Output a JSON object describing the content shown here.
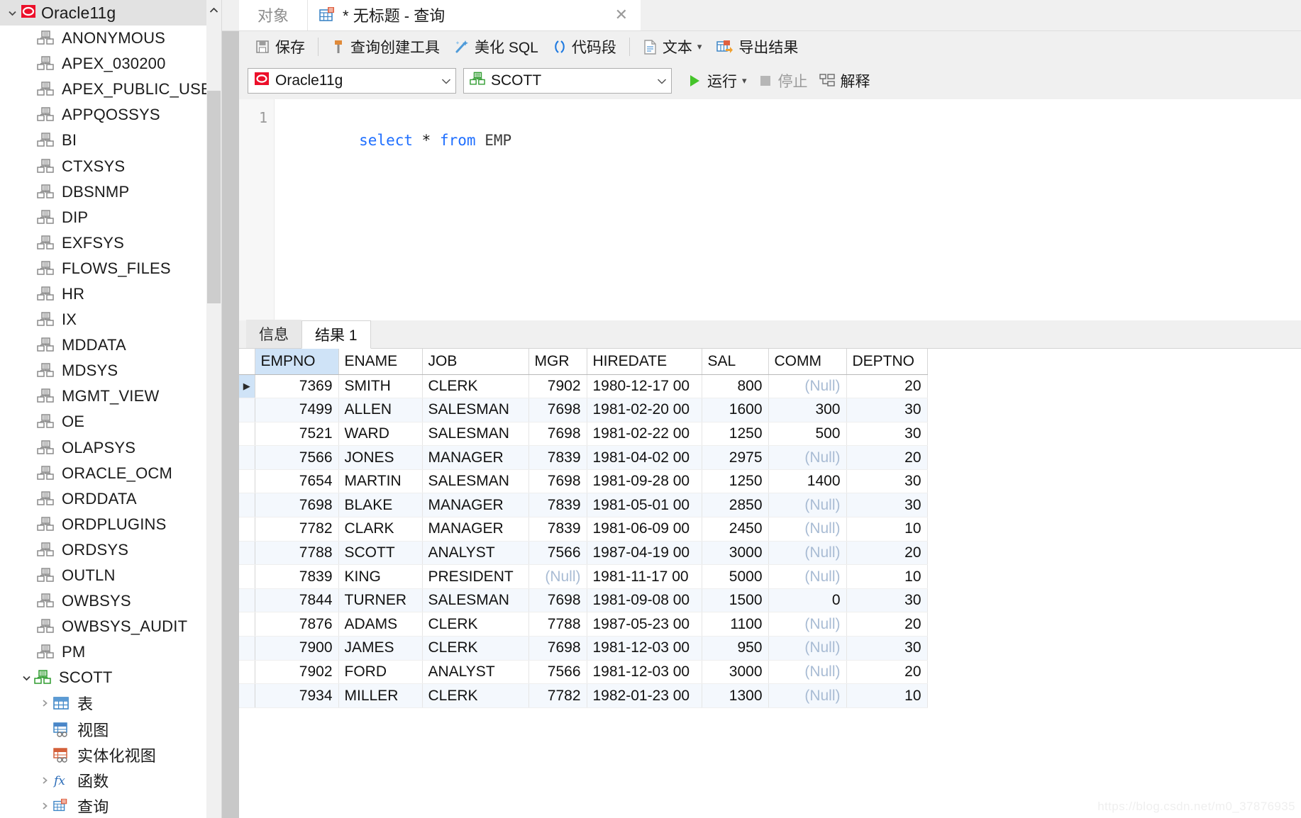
{
  "sidebar": {
    "root": {
      "label": "Oracle11g",
      "icon": "oracle-db-icon",
      "expanded": true
    },
    "users": [
      "ANONYMOUS",
      "APEX_030200",
      "APEX_PUBLIC_USER",
      "APPQOSSYS",
      "BI",
      "CTXSYS",
      "DBSNMP",
      "DIP",
      "EXFSYS",
      "FLOWS_FILES",
      "HR",
      "IX",
      "MDDATA",
      "MDSYS",
      "MGMT_VIEW",
      "OE",
      "OLAPSYS",
      "ORACLE_OCM",
      "ORDDATA",
      "ORDPLUGINS",
      "ORDSYS",
      "OUTLN",
      "OWBSYS",
      "OWBSYS_AUDIT",
      "PM"
    ],
    "scott": {
      "label": "SCOTT",
      "icon": "schema-icon",
      "expanded": true
    },
    "scott_children": [
      {
        "label": "表",
        "icon": "table-icon",
        "expandable": true
      },
      {
        "label": "视图",
        "icon": "view-icon",
        "expandable": false
      },
      {
        "label": "实体化视图",
        "icon": "materialized-view-icon",
        "expandable": false
      },
      {
        "label": "函数",
        "icon": "function-icon",
        "expandable": true
      },
      {
        "label": "查询",
        "icon": "query-icon",
        "expandable": true
      }
    ],
    "scroll_up_glyph": "⌃"
  },
  "tabs": {
    "object_tab": "对象",
    "query_tab": "* 无标题 - 查询",
    "close_glyph": "✕"
  },
  "toolbar": {
    "save": "保存",
    "query_builder": "查询创建工具",
    "beautify_sql": "美化 SQL",
    "code_snippet": "代码段",
    "text": "文本",
    "export_result": "导出结果",
    "dropdown_caret": "▾"
  },
  "toolbar2": {
    "connection": "Oracle11g",
    "schema": "SCOTT",
    "run": "运行",
    "stop": "停止",
    "explain": "解释",
    "combo_caret": "⌄",
    "run_caret": "▾"
  },
  "editor": {
    "line_number": "1",
    "sql_parts": [
      {
        "text": "select",
        "kind": "kw"
      },
      {
        "text": " ",
        "kind": "op"
      },
      {
        "text": "*",
        "kind": "op"
      },
      {
        "text": " ",
        "kind": "op"
      },
      {
        "text": "from",
        "kind": "kw"
      },
      {
        "text": " ",
        "kind": "op"
      },
      {
        "text": "EMP",
        "kind": "id"
      }
    ],
    "sql_text": "select * from EMP"
  },
  "results": {
    "tabs": [
      {
        "label": "信息",
        "active": false
      },
      {
        "label": "结果 1",
        "active": true
      }
    ],
    "columns": [
      "EMPNO",
      "ENAME",
      "JOB",
      "MGR",
      "HIREDATE",
      "SAL",
      "COMM",
      "DEPTNO"
    ],
    "selected_column": "EMPNO",
    "row_marker_glyph": "▶",
    "null_label": "(Null)",
    "rows": [
      {
        "EMPNO": "7369",
        "ENAME": "SMITH",
        "JOB": "CLERK",
        "MGR": "7902",
        "HIREDATE": "1980-12-17 00",
        "SAL": "800",
        "COMM": "(Null)",
        "DEPTNO": "20"
      },
      {
        "EMPNO": "7499",
        "ENAME": "ALLEN",
        "JOB": "SALESMAN",
        "MGR": "7698",
        "HIREDATE": "1981-02-20 00",
        "SAL": "1600",
        "COMM": "300",
        "DEPTNO": "30"
      },
      {
        "EMPNO": "7521",
        "ENAME": "WARD",
        "JOB": "SALESMAN",
        "MGR": "7698",
        "HIREDATE": "1981-02-22 00",
        "SAL": "1250",
        "COMM": "500",
        "DEPTNO": "30"
      },
      {
        "EMPNO": "7566",
        "ENAME": "JONES",
        "JOB": "MANAGER",
        "MGR": "7839",
        "HIREDATE": "1981-04-02 00",
        "SAL": "2975",
        "COMM": "(Null)",
        "DEPTNO": "20"
      },
      {
        "EMPNO": "7654",
        "ENAME": "MARTIN",
        "JOB": "SALESMAN",
        "MGR": "7698",
        "HIREDATE": "1981-09-28 00",
        "SAL": "1250",
        "COMM": "1400",
        "DEPTNO": "30"
      },
      {
        "EMPNO": "7698",
        "ENAME": "BLAKE",
        "JOB": "MANAGER",
        "MGR": "7839",
        "HIREDATE": "1981-05-01 00",
        "SAL": "2850",
        "COMM": "(Null)",
        "DEPTNO": "30"
      },
      {
        "EMPNO": "7782",
        "ENAME": "CLARK",
        "JOB": "MANAGER",
        "MGR": "7839",
        "HIREDATE": "1981-06-09 00",
        "SAL": "2450",
        "COMM": "(Null)",
        "DEPTNO": "10"
      },
      {
        "EMPNO": "7788",
        "ENAME": "SCOTT",
        "JOB": "ANALYST",
        "MGR": "7566",
        "HIREDATE": "1987-04-19 00",
        "SAL": "3000",
        "COMM": "(Null)",
        "DEPTNO": "20"
      },
      {
        "EMPNO": "7839",
        "ENAME": "KING",
        "JOB": "PRESIDENT",
        "MGR": "(Null)",
        "HIREDATE": "1981-11-17 00",
        "SAL": "5000",
        "COMM": "(Null)",
        "DEPTNO": "10"
      },
      {
        "EMPNO": "7844",
        "ENAME": "TURNER",
        "JOB": "SALESMAN",
        "MGR": "7698",
        "HIREDATE": "1981-09-08 00",
        "SAL": "1500",
        "COMM": "0",
        "DEPTNO": "30"
      },
      {
        "EMPNO": "7876",
        "ENAME": "ADAMS",
        "JOB": "CLERK",
        "MGR": "7788",
        "HIREDATE": "1987-05-23 00",
        "SAL": "1100",
        "COMM": "(Null)",
        "DEPTNO": "20"
      },
      {
        "EMPNO": "7900",
        "ENAME": "JAMES",
        "JOB": "CLERK",
        "MGR": "7698",
        "HIREDATE": "1981-12-03 00",
        "SAL": "950",
        "COMM": "(Null)",
        "DEPTNO": "30"
      },
      {
        "EMPNO": "7902",
        "ENAME": "FORD",
        "JOB": "ANALYST",
        "MGR": "7566",
        "HIREDATE": "1981-12-03 00",
        "SAL": "3000",
        "COMM": "(Null)",
        "DEPTNO": "20"
      },
      {
        "EMPNO": "7934",
        "ENAME": "MILLER",
        "JOB": "CLERK",
        "MGR": "7782",
        "HIREDATE": "1982-01-23 00",
        "SAL": "1300",
        "COMM": "(Null)",
        "DEPTNO": "10"
      }
    ]
  },
  "watermark": "https://blog.csdn.net/m0_37876935",
  "colors": {
    "accent_blue": "#1f6fff",
    "oracle_red": "#e8112d",
    "schema_green": "#3aa23a",
    "run_green": "#3dbb2f",
    "selected_header": "#cfe3f7",
    "null_text": "#a9bcd4"
  }
}
